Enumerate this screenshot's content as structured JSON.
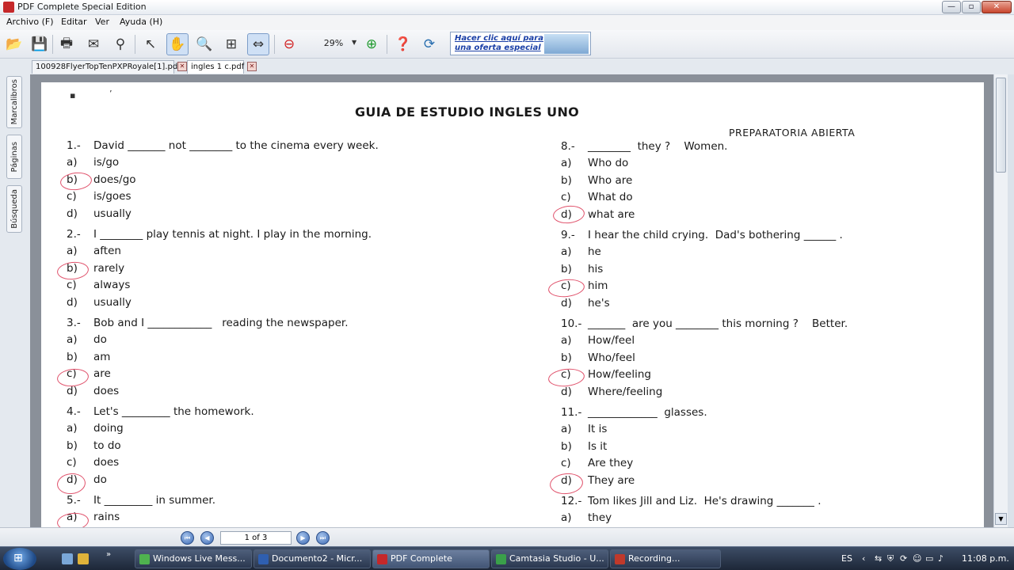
{
  "window": {
    "title": "PDF Complete Special Edition"
  },
  "menu": [
    "Archivo (F)",
    "Editar",
    "Ver",
    "Ayuda (H)"
  ],
  "toolbar": {
    "zoom": "29%",
    "promo_text": "Hacer clic aquí para una oferta especial"
  },
  "tabs": [
    {
      "label": "100928FlyerTopTenPXPRoyale[1].pdf"
    },
    {
      "label": "ingles 1 c.pdf"
    }
  ],
  "side_tabs": [
    "Marcalibros",
    "Páginas",
    "Búsqueda"
  ],
  "document": {
    "title": "GUIA DE ESTUDIO INGLES UNO",
    "subtitle": "PREPARATORIA ABIERTA",
    "left": [
      {
        "num": "1.-",
        "stem": "David _______ not ________ to the cinema every week.",
        "options": [
          {
            "l": "a)",
            "t": "is/go"
          },
          {
            "l": "b)",
            "t": "does/go"
          },
          {
            "l": "c)",
            "t": "is/goes"
          },
          {
            "l": "d)",
            "t": "usually"
          }
        ]
      },
      {
        "num": "2.-",
        "stem": "I ________ play tennis at night. I play in the morning.",
        "options": [
          {
            "l": "a)",
            "t": "aften"
          },
          {
            "l": "b)",
            "t": "rarely"
          },
          {
            "l": "c)",
            "t": "always"
          },
          {
            "l": "d)",
            "t": "usually"
          }
        ]
      },
      {
        "num": "3.-",
        "stem": "Bob and I ____________   reading the newspaper.",
        "options": [
          {
            "l": "a)",
            "t": "do"
          },
          {
            "l": "b)",
            "t": "am"
          },
          {
            "l": "c)",
            "t": "are"
          },
          {
            "l": "d)",
            "t": "does"
          }
        ]
      },
      {
        "num": "4.-",
        "stem": "Let's _________ the homework.",
        "options": [
          {
            "l": "a)",
            "t": "doing"
          },
          {
            "l": "b)",
            "t": "to do"
          },
          {
            "l": "c)",
            "t": "does"
          },
          {
            "l": "d)",
            "t": "do"
          }
        ]
      },
      {
        "num": "5.-",
        "stem": "It _________ in summer.",
        "options": [
          {
            "l": "a)",
            "t": "rains"
          }
        ]
      }
    ],
    "right": [
      {
        "num": "8.-",
        "stem": "________  they ?    Women.",
        "options": [
          {
            "l": "a)",
            "t": "Who do"
          },
          {
            "l": "b)",
            "t": "Who are"
          },
          {
            "l": "c)",
            "t": "What do"
          },
          {
            "l": "d)",
            "t": "what are"
          }
        ]
      },
      {
        "num": "9.-",
        "stem": "I hear the child crying.  Dad's bothering ______ .",
        "options": [
          {
            "l": "a)",
            "t": "he"
          },
          {
            "l": "b)",
            "t": "his"
          },
          {
            "l": "c)",
            "t": "him"
          },
          {
            "l": "d)",
            "t": "he's"
          }
        ]
      },
      {
        "num": "10.-",
        "stem": "_______  are you ________ this morning ?    Better.",
        "options": [
          {
            "l": "a)",
            "t": "How/feel"
          },
          {
            "l": "b)",
            "t": "Who/feel"
          },
          {
            "l": "c)",
            "t": "How/feeling"
          },
          {
            "l": "d)",
            "t": "Where/feeling"
          }
        ]
      },
      {
        "num": "11.-",
        "stem": "_____________  glasses.",
        "options": [
          {
            "l": "a)",
            "t": "It is"
          },
          {
            "l": "b)",
            "t": "Is it"
          },
          {
            "l": "c)",
            "t": "Are they"
          },
          {
            "l": "d)",
            "t": "They are"
          }
        ]
      },
      {
        "num": "12.-",
        "stem": "Tom likes Jill and Liz.  He's drawing _______ .",
        "options": [
          {
            "l": "a)",
            "t": "they"
          }
        ]
      }
    ]
  },
  "nav": {
    "page_indicator": "1 of 3"
  },
  "taskbar": {
    "tasks": [
      "Windows Live Mess...",
      "Documento2 - Micr...",
      "PDF Complete",
      "Camtasia Studio - U...",
      "Recording..."
    ],
    "lang": "ES",
    "clock": "11:08 p.m."
  }
}
